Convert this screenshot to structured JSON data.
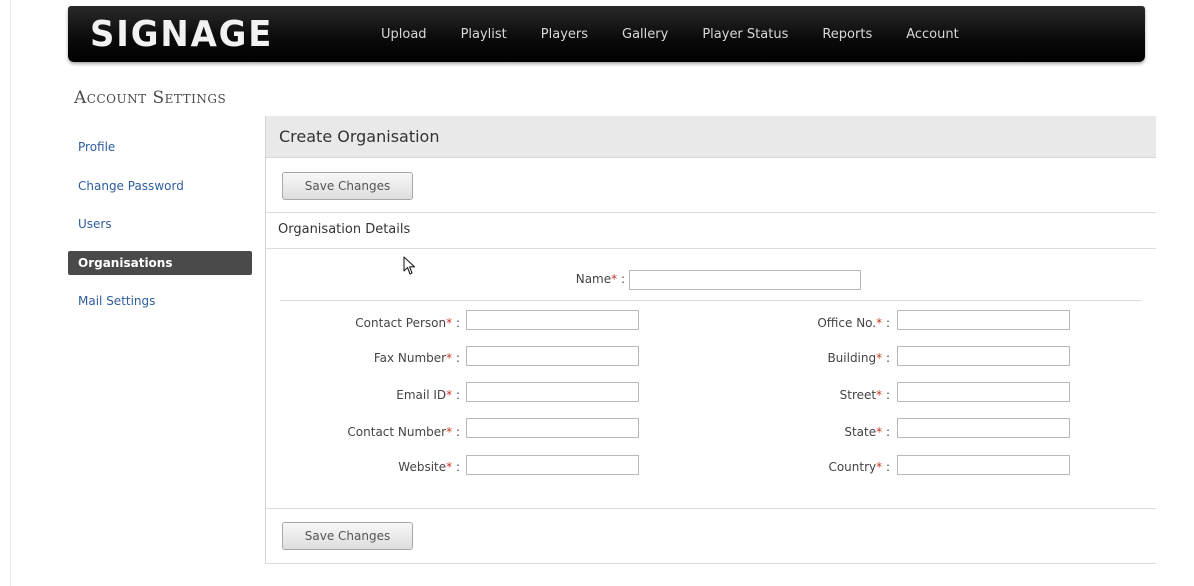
{
  "app": {
    "logo": "SIGNAGE",
    "nav": [
      "Upload",
      "Playlist",
      "Players",
      "Gallery",
      "Player Status",
      "Reports",
      "Account"
    ]
  },
  "page": {
    "title": "Account Settings"
  },
  "sidebar": {
    "items": [
      {
        "label": "Profile",
        "active": false
      },
      {
        "label": "Change Password",
        "active": false
      },
      {
        "label": "Users",
        "active": false
      },
      {
        "label": "Organisations",
        "active": true
      },
      {
        "label": "Mail Settings",
        "active": false
      }
    ]
  },
  "main": {
    "header": "Create Organisation",
    "save_label": "Save Changes",
    "section_title": "Organisation Details",
    "required_mark": "*",
    "separator": ":",
    "name_field": {
      "label": "Name",
      "value": ""
    },
    "left_fields": [
      {
        "label": "Contact Person",
        "value": ""
      },
      {
        "label": "Fax Number",
        "value": ""
      },
      {
        "label": "Email ID",
        "value": ""
      },
      {
        "label": "Contact Number",
        "value": ""
      },
      {
        "label": "Website",
        "value": ""
      }
    ],
    "right_fields": [
      {
        "label": "Office No.",
        "value": ""
      },
      {
        "label": "Building",
        "value": ""
      },
      {
        "label": "Street",
        "value": ""
      },
      {
        "label": "State",
        "value": ""
      },
      {
        "label": "Country",
        "value": ""
      }
    ]
  },
  "colors": {
    "nav_background": "#000000",
    "link": "#2f5d9e",
    "active_item": "#4a4a4a",
    "required": "#c0392b"
  }
}
